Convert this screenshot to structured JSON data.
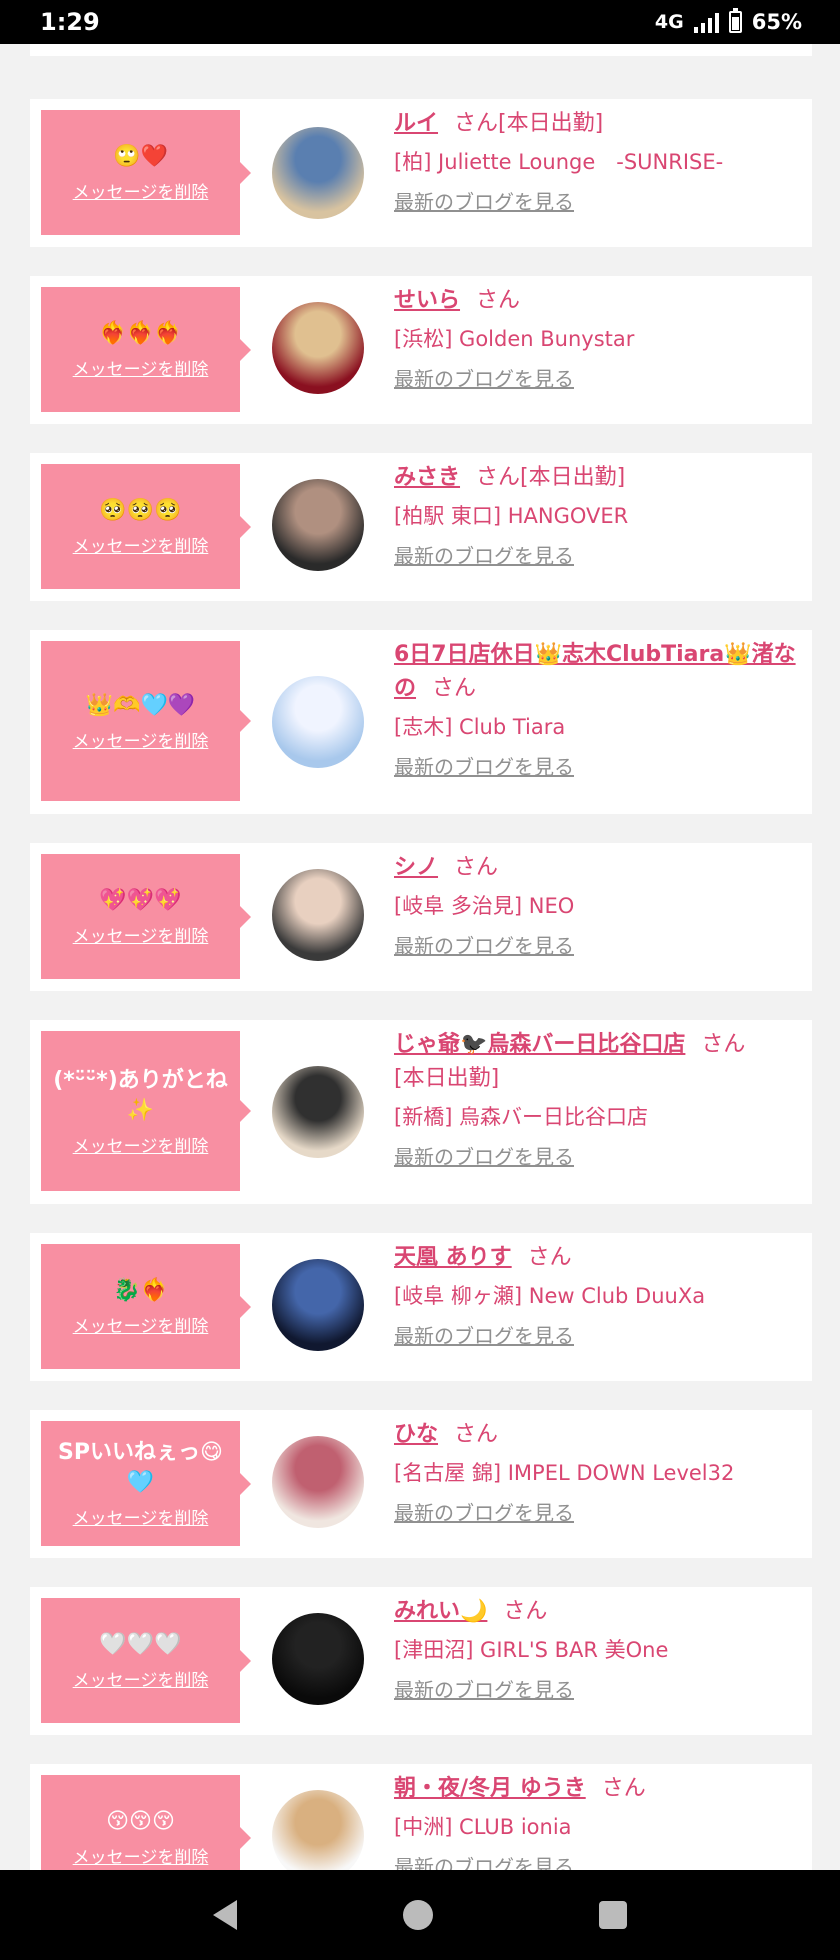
{
  "status_bar": {
    "time": "1:29",
    "network": "4G",
    "battery": "65%"
  },
  "common": {
    "delete_label": "メッセージを削除",
    "blog_label": "最新のブログを見る",
    "san": "さん"
  },
  "cards": [
    {
      "message": "🙄❤️",
      "name": "ルイ",
      "note": "[本日出勤]",
      "shop": "[柏] Juliette Lounge　-SUNRISE-",
      "avatar_colors": [
        "#d8c3a0",
        "#5a7fb0"
      ]
    },
    {
      "message": "❤️‍🔥❤️‍🔥❤️‍🔥",
      "name": "せいら",
      "note": "",
      "shop": "[浜松] Golden Bunystar",
      "avatar_colors": [
        "#8a1020",
        "#e0c090"
      ]
    },
    {
      "message": "🥺🥺🥺",
      "name": "みさき",
      "note": "[本日出勤]",
      "shop": "[柏駅 東口] HANGOVER",
      "avatar_colors": [
        "#2a2a2a",
        "#b09080"
      ]
    },
    {
      "message": "👑🫶🩵💜",
      "name": "6日7日店休日👑志木ClubTiara👑渚なの",
      "note": "",
      "shop": "[志木] Club Tiara",
      "avatar_colors": [
        "#a8c8ec",
        "#f0f4ff"
      ]
    },
    {
      "message": "💖💖💖",
      "name": "シノ",
      "note": "",
      "shop": "[岐阜 多治見] NEO",
      "avatar_colors": [
        "#3a3a3a",
        "#e8d0c0"
      ]
    },
    {
      "message": "(*ᵕ̈ᵕ̈*)ありがとね✨",
      "name": "じゃ爺🐦‍⬛烏森バー日比谷口店",
      "note": "[本日出勤]",
      "shop": "[新橋] 烏森バー日比谷口店",
      "avatar_colors": [
        "#e6d9c8",
        "#303030"
      ]
    },
    {
      "message": "🐉❤️‍🔥",
      "name": "天凰 ありす",
      "note": "",
      "shop": "[岐阜 柳ヶ瀬] New Club DuuXa",
      "avatar_colors": [
        "#101830",
        "#4466aa"
      ]
    },
    {
      "message": "SPいいねぇっ😋🩵",
      "name": "ひな",
      "note": "",
      "shop": "[名古屋 錦] IMPEL DOWN Level32",
      "avatar_colors": [
        "#f0e6e0",
        "#c06070"
      ]
    },
    {
      "message": "🤍🤍🤍",
      "name": "みれい🌙",
      "note": "",
      "shop": "[津田沼] GIRL'S BAR 美One",
      "avatar_colors": [
        "#0a0a0a",
        "#222"
      ]
    },
    {
      "message": "😚😚😚",
      "name": "朝・夜/冬月 ゆうき",
      "note": "",
      "shop": "[中洲] CLUB ionia",
      "avatar_colors": [
        "#f8f8f8",
        "#d9b080"
      ]
    }
  ]
}
